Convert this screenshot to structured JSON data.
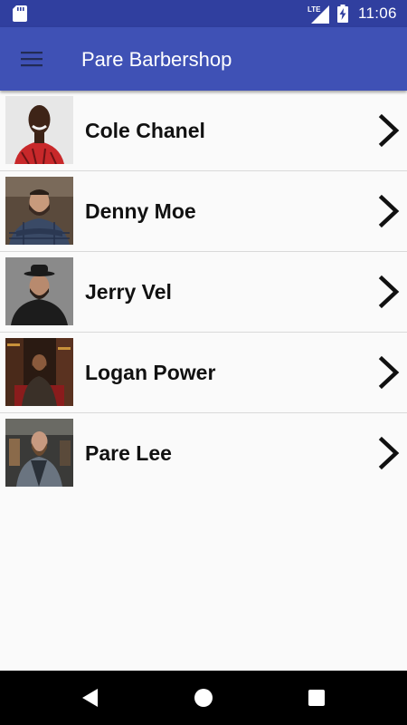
{
  "status_bar": {
    "time": "11:06",
    "network_label": "LTE",
    "icons": [
      "sd-card-icon",
      "lte-signal-icon",
      "battery-charging-icon"
    ]
  },
  "app_bar": {
    "title": "Pare Barbershop",
    "menu_icon": "hamburger-menu-icon"
  },
  "barbers": [
    {
      "name": "Cole Chanel",
      "photo_icon": "barber-photo",
      "action_icon": "chevron-right-icon"
    },
    {
      "name": "Denny Moe",
      "photo_icon": "barber-photo",
      "action_icon": "chevron-right-icon"
    },
    {
      "name": "Jerry Vel",
      "photo_icon": "barber-photo",
      "action_icon": "chevron-right-icon"
    },
    {
      "name": "Logan Power",
      "photo_icon": "barber-photo",
      "action_icon": "chevron-right-icon"
    },
    {
      "name": "Pare Lee",
      "photo_icon": "barber-photo",
      "action_icon": "chevron-right-icon"
    }
  ],
  "nav_bar": {
    "icons": [
      "back-icon",
      "home-icon",
      "recents-icon"
    ]
  },
  "colors": {
    "status_bar": "#303f9f",
    "app_bar": "#3f51b5",
    "background": "#fafafa",
    "divider": "#d9d9d9",
    "nav_bar": "#000000"
  }
}
